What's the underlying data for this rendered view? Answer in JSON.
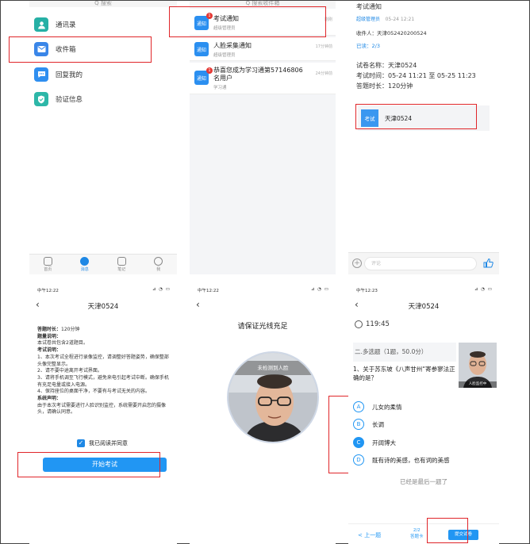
{
  "panel1": {
    "search_cut": "Q 搜索",
    "items": [
      {
        "label": "通讯录",
        "icon": "contacts-icon",
        "color": "#26b0a5"
      },
      {
        "label": "收件箱",
        "icon": "inbox-icon",
        "color": "#3a86e8"
      },
      {
        "label": "回复我的",
        "icon": "reply-icon",
        "color": "#2f8ff0"
      },
      {
        "label": "验证信息",
        "icon": "verify-icon",
        "color": "#2db7a8"
      }
    ],
    "tabs": [
      {
        "label": "首页"
      },
      {
        "label": "消息"
      },
      {
        "label": "笔记"
      },
      {
        "label": "我"
      }
    ]
  },
  "panel2": {
    "search_cut": "Q 搜索收件箱",
    "messages": [
      {
        "icon_text": "通知",
        "badge": "1",
        "title": "考试通知",
        "sub": "超级管理员",
        "time": "刚刚"
      },
      {
        "icon_text": "通知",
        "badge": "",
        "title": "人脸采集通知",
        "sub": "超级管理员",
        "time": "17分钟前"
      },
      {
        "icon_text": "通知",
        "badge": "1",
        "title": "恭喜您成为学习通第57146806名用户",
        "sub": "学习通",
        "time": "24分钟前"
      }
    ]
  },
  "panel3": {
    "title": "考试通知",
    "sender": "超级管理员",
    "sent_time": "05-24 12:21",
    "receiver": "收件人：天津052420200524",
    "read": "已读：2/3",
    "exam_name": "试卷名称：天津0524",
    "exam_time": "考试时间：05-24 11:21 至 05-25 11:23",
    "duration": "答题时长：120分钟",
    "attachment_icon": "考试",
    "attachment_label": "天津0524",
    "comment_placeholder": "评论"
  },
  "panel4": {
    "status_time": "中午12:22",
    "status_icons": "⊿ ◔ ▭",
    "nav_title": "天津0524",
    "lines": [
      {
        "text": "答题时长：120分钟",
        "bold": false
      },
      {
        "text": "题量说明：",
        "bold": true
      },
      {
        "text": "本试卷共包含2道题目。",
        "bold": false
      },
      {
        "text": "考试说明：",
        "bold": true
      },
      {
        "text": "1、本次考试全程进行录像监控，请调整好答题姿势，确保整部头像完整显示。",
        "bold": false
      },
      {
        "text": "2、请不要中途离开考试界面。",
        "bold": false
      },
      {
        "text": "3、请将手机调至飞行模式，避免来电引起考试中断。确保手机有充足电量或接入电源。",
        "bold": false
      },
      {
        "text": "4、保持座位的桌面干净，不要有与考试无关的内容。",
        "bold": false
      },
      {
        "text": "系统声明：",
        "bold": true
      },
      {
        "text": "由于本次考试需要进行人脸识别监控，系统需要开启您的摄像头，请确认同意。",
        "bold": false
      }
    ],
    "agree": "我已阅读并同意",
    "start_btn": "开始考试"
  },
  "panel5": {
    "status_time": "中午12:22",
    "status_icons": "⊿ ◔ ▭",
    "title": "请保证光线充足",
    "banner": "未检测到人脸"
  },
  "panel6": {
    "status_time": "中午12:23",
    "status_icons": "⊿ ◔ ▭",
    "nav_title": "天津0524",
    "timer": "119:45",
    "section": "二.多选题（1题，50.0分）",
    "question": "1、关于苏东坡《八声甘州“寄参寥法正确的是？",
    "thumb_caption": "人脸监控中",
    "options": [
      {
        "letter": "A",
        "text": "儿女的柔情",
        "selected": false
      },
      {
        "letter": "B",
        "text": "长调",
        "selected": false
      },
      {
        "letter": "C",
        "text": "开阔博大",
        "selected": true
      },
      {
        "letter": "D",
        "text": "既有诗的美感，也有词的美感",
        "selected": false
      }
    ],
    "last_note": "已经是最后一题了",
    "prev": "< 上一题",
    "pager_num": "2/2",
    "pager_label": "答题卡",
    "submit": "提交试卷"
  }
}
